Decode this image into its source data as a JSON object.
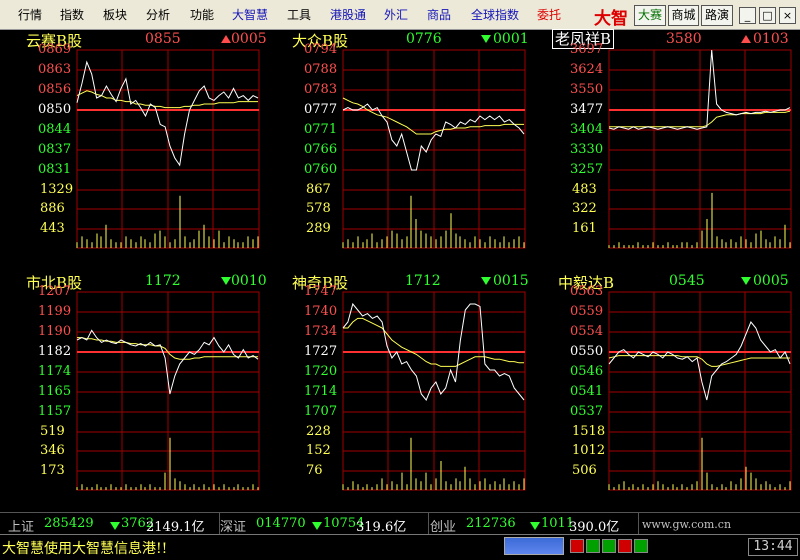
{
  "menu": {
    "items": [
      "行情",
      "指数",
      "板块",
      "分析",
      "功能",
      "大智慧",
      "工具",
      "港股通",
      "外汇",
      "商品",
      "全球指数",
      "委托"
    ],
    "colors": [
      "black",
      "black",
      "black",
      "black",
      "black",
      "blue",
      "black",
      "blue",
      "blue",
      "blue",
      "blue",
      "red"
    ],
    "logo": "大智",
    "buttons": [
      "大赛",
      "商城",
      "路演"
    ],
    "window_buttons": [
      "_",
      "□",
      "×"
    ]
  },
  "panels": [
    {
      "name": "云赛B股",
      "name_boxed": false,
      "price": "0855",
      "direction": "up",
      "change": "0005",
      "price_color": "#ff5050",
      "change_color": "#ff5050",
      "price_labels": [
        "0869",
        "0863",
        "0856",
        "0850",
        "0844",
        "0837",
        "0831"
      ],
      "volume_labels": [
        "1329",
        "886",
        "443"
      ]
    },
    {
      "name": "大众B股",
      "name_boxed": false,
      "price": "0776",
      "direction": "down",
      "change": "0001",
      "price_color": "#30ff30",
      "change_color": "#30ff30",
      "price_labels": [
        "0794",
        "0788",
        "0783",
        "0777",
        "0771",
        "0766",
        "0760"
      ],
      "volume_labels": [
        "867",
        "578",
        "289"
      ]
    },
    {
      "name": "老凤祥B",
      "name_boxed": true,
      "price": "3580",
      "direction": "up",
      "change": "0103",
      "price_color": "#ff5050",
      "change_color": "#ff5050",
      "price_labels": [
        "3697",
        "3624",
        "3550",
        "3477",
        "3404",
        "3330",
        "3257"
      ],
      "volume_labels": [
        "483",
        "322",
        "161"
      ]
    },
    {
      "name": "市北B股",
      "name_boxed": false,
      "price": "1172",
      "direction": "down",
      "change": "0010",
      "price_color": "#30ff30",
      "change_color": "#30ff30",
      "price_labels": [
        "1207",
        "1199",
        "1190",
        "1182",
        "1174",
        "1165",
        "1157"
      ],
      "volume_labels": [
        "519",
        "346",
        "173"
      ]
    },
    {
      "name": "神奇B股",
      "name_boxed": false,
      "price": "1712",
      "direction": "down",
      "change": "0015",
      "price_color": "#30ff30",
      "change_color": "#30ff30",
      "price_labels": [
        "1747",
        "1740",
        "1734",
        "1727",
        "1720",
        "1714",
        "1707"
      ],
      "volume_labels": [
        "228",
        "152",
        "76"
      ]
    },
    {
      "name": "中毅达B",
      "name_boxed": false,
      "price": "0545",
      "direction": "down",
      "change": "0005",
      "price_color": "#30ff30",
      "change_color": "#30ff30",
      "price_labels": [
        "0563",
        "0559",
        "0554",
        "0550",
        "0546",
        "0541",
        "0537"
      ],
      "volume_labels": [
        "1518",
        "1012",
        "506"
      ]
    }
  ],
  "chart_data": [
    {
      "type": "line",
      "title": "云赛B股",
      "series": [
        {
          "values": [
            0.56,
            0.72,
            0.9,
            0.8,
            0.6,
            0.62,
            0.7,
            0.63,
            0.57,
            0.68,
            0.76,
            0.55,
            0.58,
            0.52,
            0.45,
            0.55,
            0.52,
            0.38,
            0.36,
            0.2,
            0.1,
            0.04,
            0.3,
            0.5,
            0.58,
            0.66,
            0.7,
            0.6,
            0.58,
            0.62,
            0.65,
            0.6,
            0.68,
            0.6,
            0.62,
            0.58,
            0.62,
            0.6
          ]
        },
        {
          "values": [
            0.62,
            0.64,
            0.66,
            0.65,
            0.63,
            0.62,
            0.6,
            0.6,
            0.58,
            0.58,
            0.57,
            0.57,
            0.55,
            0.55,
            0.54,
            0.54,
            0.53,
            0.53,
            0.52,
            0.52,
            0.52,
            0.52,
            0.53,
            0.53,
            0.54,
            0.54,
            0.55,
            0.55,
            0.55,
            0.56,
            0.56,
            0.56,
            0.56,
            0.57,
            0.57,
            0.57,
            0.57,
            0.57
          ]
        }
      ],
      "volumes": [
        0.1,
        0.2,
        0.15,
        0.1,
        0.25,
        0.2,
        0.4,
        0.15,
        0.1,
        0.1,
        0.2,
        0.15,
        0.1,
        0.2,
        0.15,
        0.1,
        0.25,
        0.3,
        0.2,
        0.1,
        0.15,
        0.9,
        0.2,
        0.1,
        0.15,
        0.3,
        0.4,
        0.2,
        0.15,
        0.3,
        0.1,
        0.2,
        0.15,
        0.1,
        0.1,
        0.2,
        0.15,
        0.2
      ]
    },
    {
      "type": "line",
      "title": "大众B股",
      "series": [
        {
          "values": [
            0.5,
            0.52,
            0.5,
            0.5,
            0.52,
            0.55,
            0.5,
            0.52,
            0.45,
            0.4,
            0.25,
            0.2,
            0.3,
            0.15,
            0.0,
            0.0,
            0.2,
            0.15,
            0.25,
            0.3,
            0.28,
            0.4,
            0.38,
            0.35,
            0.4,
            0.38,
            0.42,
            0.4,
            0.45,
            0.42,
            0.45,
            0.42,
            0.45,
            0.4,
            0.42,
            0.38,
            0.35,
            0.3
          ]
        },
        {
          "values": [
            0.6,
            0.58,
            0.56,
            0.55,
            0.53,
            0.5,
            0.48,
            0.46,
            0.45,
            0.44,
            0.42,
            0.4,
            0.38,
            0.36,
            0.33,
            0.3,
            0.3,
            0.3,
            0.3,
            0.32,
            0.33,
            0.34,
            0.34,
            0.35,
            0.35,
            0.35,
            0.36,
            0.36,
            0.36,
            0.37,
            0.37,
            0.37,
            0.37,
            0.38,
            0.38,
            0.38,
            0.38,
            0.38
          ]
        }
      ],
      "volumes": [
        0.1,
        0.15,
        0.1,
        0.2,
        0.1,
        0.15,
        0.25,
        0.1,
        0.15,
        0.2,
        0.3,
        0.25,
        0.15,
        0.2,
        0.9,
        0.5,
        0.3,
        0.25,
        0.2,
        0.15,
        0.2,
        0.3,
        0.6,
        0.25,
        0.2,
        0.15,
        0.1,
        0.2,
        0.15,
        0.1,
        0.2,
        0.15,
        0.1,
        0.2,
        0.1,
        0.15,
        0.2,
        0.1
      ]
    },
    {
      "type": "line",
      "title": "老凤祥B",
      "series": [
        {
          "values": [
            0.35,
            0.34,
            0.36,
            0.35,
            0.34,
            0.36,
            0.34,
            0.35,
            0.36,
            0.35,
            0.34,
            0.35,
            0.36,
            0.35,
            0.34,
            0.35,
            0.36,
            0.35,
            0.34,
            0.35,
            0.36,
            1.0,
            0.55,
            0.5,
            0.48,
            0.47,
            0.46,
            0.47,
            0.48,
            0.47,
            0.48,
            0.48,
            0.49,
            0.48,
            0.49,
            0.5,
            0.5,
            0.52
          ]
        },
        {
          "values": [
            0.36,
            0.36,
            0.36,
            0.36,
            0.36,
            0.36,
            0.36,
            0.36,
            0.36,
            0.36,
            0.36,
            0.36,
            0.36,
            0.36,
            0.36,
            0.36,
            0.36,
            0.36,
            0.36,
            0.36,
            0.37,
            0.4,
            0.44,
            0.45,
            0.46,
            0.46,
            0.46,
            0.47,
            0.47,
            0.47,
            0.47,
            0.47,
            0.48,
            0.48,
            0.48,
            0.48,
            0.48,
            0.49
          ]
        }
      ],
      "volumes": [
        0.05,
        0.05,
        0.1,
        0.05,
        0.05,
        0.05,
        0.1,
        0.05,
        0.05,
        0.1,
        0.05,
        0.05,
        0.1,
        0.05,
        0.05,
        0.1,
        0.1,
        0.05,
        0.1,
        0.3,
        0.5,
        0.95,
        0.2,
        0.15,
        0.1,
        0.15,
        0.1,
        0.2,
        0.15,
        0.1,
        0.25,
        0.3,
        0.15,
        0.1,
        0.2,
        0.15,
        0.4,
        0.1
      ]
    },
    {
      "type": "line",
      "title": "市北B股",
      "series": [
        {
          "values": [
            0.6,
            0.62,
            0.6,
            0.68,
            0.62,
            0.58,
            0.6,
            0.58,
            0.57,
            0.6,
            0.58,
            0.56,
            0.55,
            0.57,
            0.55,
            0.58,
            0.55,
            0.56,
            0.45,
            0.15,
            0.3,
            0.4,
            0.45,
            0.5,
            0.48,
            0.52,
            0.58,
            0.56,
            0.62,
            0.55,
            0.5,
            0.56,
            0.48,
            0.45,
            0.52,
            0.45,
            0.47,
            0.44
          ]
        },
        {
          "values": [
            0.62,
            0.62,
            0.61,
            0.61,
            0.6,
            0.6,
            0.59,
            0.59,
            0.58,
            0.58,
            0.58,
            0.57,
            0.57,
            0.56,
            0.56,
            0.56,
            0.55,
            0.55,
            0.53,
            0.48,
            0.45,
            0.44,
            0.44,
            0.44,
            0.45,
            0.45,
            0.46,
            0.46,
            0.46,
            0.46,
            0.46,
            0.46,
            0.46,
            0.46,
            0.46,
            0.46,
            0.46,
            0.46
          ]
        }
      ],
      "volumes": [
        0.05,
        0.1,
        0.05,
        0.05,
        0.1,
        0.05,
        0.05,
        0.1,
        0.05,
        0.05,
        0.1,
        0.05,
        0.05,
        0.1,
        0.05,
        0.1,
        0.05,
        0.05,
        0.3,
        0.9,
        0.2,
        0.15,
        0.1,
        0.05,
        0.1,
        0.05,
        0.1,
        0.05,
        0.1,
        0.05,
        0.1,
        0.05,
        0.05,
        0.1,
        0.05,
        0.05,
        0.1,
        0.05
      ]
    },
    {
      "type": "line",
      "title": "神奇B股",
      "series": [
        {
          "values": [
            0.7,
            0.75,
            0.9,
            0.85,
            0.8,
            0.82,
            0.78,
            0.8,
            0.75,
            0.55,
            0.45,
            0.5,
            0.4,
            0.42,
            0.35,
            0.3,
            0.15,
            0.1,
            0.2,
            0.25,
            0.15,
            0.2,
            0.35,
            0.25,
            0.6,
            0.85,
            0.9,
            0.9,
            0.88,
            0.4,
            0.35,
            0.35,
            0.3,
            0.32,
            0.3,
            0.2,
            0.15,
            0.1
          ]
        },
        {
          "values": [
            0.7,
            0.7,
            0.75,
            0.78,
            0.78,
            0.76,
            0.74,
            0.72,
            0.7,
            0.65,
            0.6,
            0.57,
            0.54,
            0.52,
            0.5,
            0.48,
            0.45,
            0.42,
            0.4,
            0.4,
            0.38,
            0.38,
            0.38,
            0.38,
            0.4,
            0.42,
            0.44,
            0.46,
            0.46,
            0.46,
            0.45,
            0.44,
            0.44,
            0.43,
            0.42,
            0.42,
            0.41,
            0.41
          ]
        }
      ],
      "volumes": [
        0.1,
        0.05,
        0.15,
        0.1,
        0.05,
        0.1,
        0.05,
        0.1,
        0.2,
        0.1,
        0.15,
        0.1,
        0.3,
        0.1,
        0.9,
        0.2,
        0.15,
        0.3,
        0.1,
        0.2,
        0.5,
        0.15,
        0.1,
        0.2,
        0.15,
        0.4,
        0.2,
        0.1,
        0.15,
        0.2,
        0.1,
        0.15,
        0.1,
        0.2,
        0.1,
        0.15,
        0.1,
        0.2
      ]
    },
    {
      "type": "line",
      "title": "中毅达B",
      "series": [
        {
          "values": [
            0.4,
            0.45,
            0.5,
            0.52,
            0.48,
            0.45,
            0.5,
            0.48,
            0.46,
            0.5,
            0.48,
            0.45,
            0.5,
            0.48,
            0.45,
            0.44,
            0.46,
            0.42,
            0.45,
            0.25,
            0.1,
            0.3,
            0.35,
            0.4,
            0.42,
            0.45,
            0.48,
            0.55,
            0.65,
            0.75,
            0.7,
            0.6,
            0.55,
            0.5,
            0.52,
            0.45,
            0.5,
            0.4
          ]
        },
        {
          "values": [
            0.45,
            0.46,
            0.47,
            0.47,
            0.47,
            0.47,
            0.47,
            0.47,
            0.47,
            0.47,
            0.47,
            0.47,
            0.47,
            0.47,
            0.47,
            0.46,
            0.46,
            0.46,
            0.46,
            0.44,
            0.4,
            0.38,
            0.38,
            0.39,
            0.4,
            0.41,
            0.42,
            0.43,
            0.44,
            0.45,
            0.45,
            0.45,
            0.45,
            0.45,
            0.45,
            0.45,
            0.45,
            0.45
          ]
        }
      ],
      "volumes": [
        0.1,
        0.05,
        0.1,
        0.15,
        0.05,
        0.1,
        0.05,
        0.1,
        0.05,
        0.1,
        0.15,
        0.1,
        0.05,
        0.1,
        0.05,
        0.1,
        0.05,
        0.1,
        0.15,
        0.9,
        0.3,
        0.1,
        0.05,
        0.1,
        0.05,
        0.15,
        0.1,
        0.2,
        0.4,
        0.3,
        0.2,
        0.1,
        0.15,
        0.1,
        0.05,
        0.1,
        0.05,
        0.15
      ]
    }
  ],
  "status": {
    "sh_label": "上证",
    "sh_value": "285429",
    "sh_change": "3762",
    "sh_amount": "2149.1亿",
    "sz_label": "深证",
    "sz_value": "014770",
    "sz_change": "10754",
    "sz_amount": "319.6亿",
    "cy_label": "创业",
    "cy_value": "212736",
    "cy_change": "1011",
    "cy_amount": "390.0亿",
    "url": "www.gw.com.cn"
  },
  "ticker": {
    "text": "大智慧使用大智慧信息港!!",
    "time": "13:44",
    "indicator_colors": [
      "#d00000",
      "#00a000",
      "#00a000",
      "#d00000",
      "#00a000"
    ]
  },
  "colors": {
    "grid": "#a00000",
    "base_line": "#ff3030",
    "price_line": "#ffffff",
    "avg_line": "#ffff54",
    "volume": "#ffff54"
  }
}
